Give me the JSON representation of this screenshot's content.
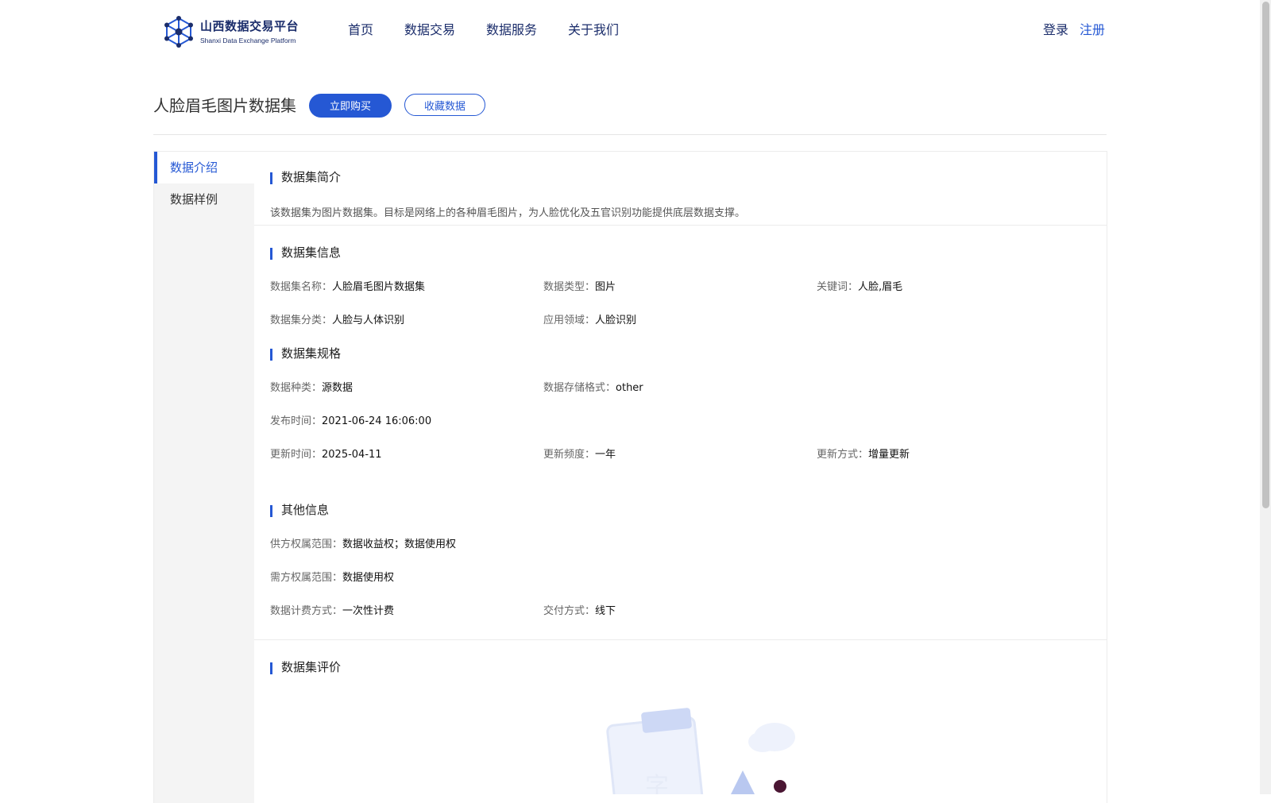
{
  "header": {
    "logo_cn": "山西数据交易平台",
    "logo_en": "Shanxi Data Exchange Platform",
    "nav": [
      "首页",
      "数据交易",
      "数据服务",
      "关于我们"
    ],
    "login": "登录",
    "register": "注册"
  },
  "dataset": {
    "title": "人脸眉毛图片数据集",
    "buy_label": "立即购买",
    "favorite_label": "收藏数据"
  },
  "sidebar": {
    "items": [
      {
        "label": "数据介绍",
        "active": true
      },
      {
        "label": "数据样例",
        "active": false
      }
    ]
  },
  "sections": {
    "intro": {
      "title": "数据集简介",
      "text": "该数据集为图片数据集。目标是网络上的各种眉毛图片，为人脸优化及五官识别功能提供底层数据支撑。"
    },
    "info": {
      "title": "数据集信息",
      "name_k": "数据集名称：",
      "name_v": "人脸眉毛图片数据集",
      "type_k": "数据类型：",
      "type_v": "图片",
      "kw_k": "关键词：",
      "kw_v": "人脸,眉毛",
      "cat_k": "数据集分类：",
      "cat_v": "人脸与人体识别",
      "domain_k": "应用领域：",
      "domain_v": "人脸识别"
    },
    "spec": {
      "title": "数据集规格",
      "kind_k": "数据种类：",
      "kind_v": "源数据",
      "format_k": "数据存储格式：",
      "format_v": "other",
      "pub_k": "发布时间：",
      "pub_v": "2021-06-24 16:06:00",
      "upd_k": "更新时间：",
      "upd_v": "2025-04-11",
      "freq_k": "更新频度：",
      "freq_v": "一年",
      "mode_k": "更新方式：",
      "mode_v": "增量更新"
    },
    "other": {
      "title": "其他信息",
      "supply_k": "供方权属范围：",
      "supply_v": "数据收益权；数据使用权",
      "demand_k": "需方权属范围：",
      "demand_v": "数据使用权",
      "billing_k": "数据计费方式：",
      "billing_v": "一次性计费",
      "delivery_k": "交付方式：",
      "delivery_v": "线下"
    },
    "review": {
      "title": "数据集评价"
    }
  },
  "colors": {
    "accent": "#2558d4",
    "nav_text": "#1b2d6b",
    "sidebar_bg": "#f4f4f4"
  }
}
